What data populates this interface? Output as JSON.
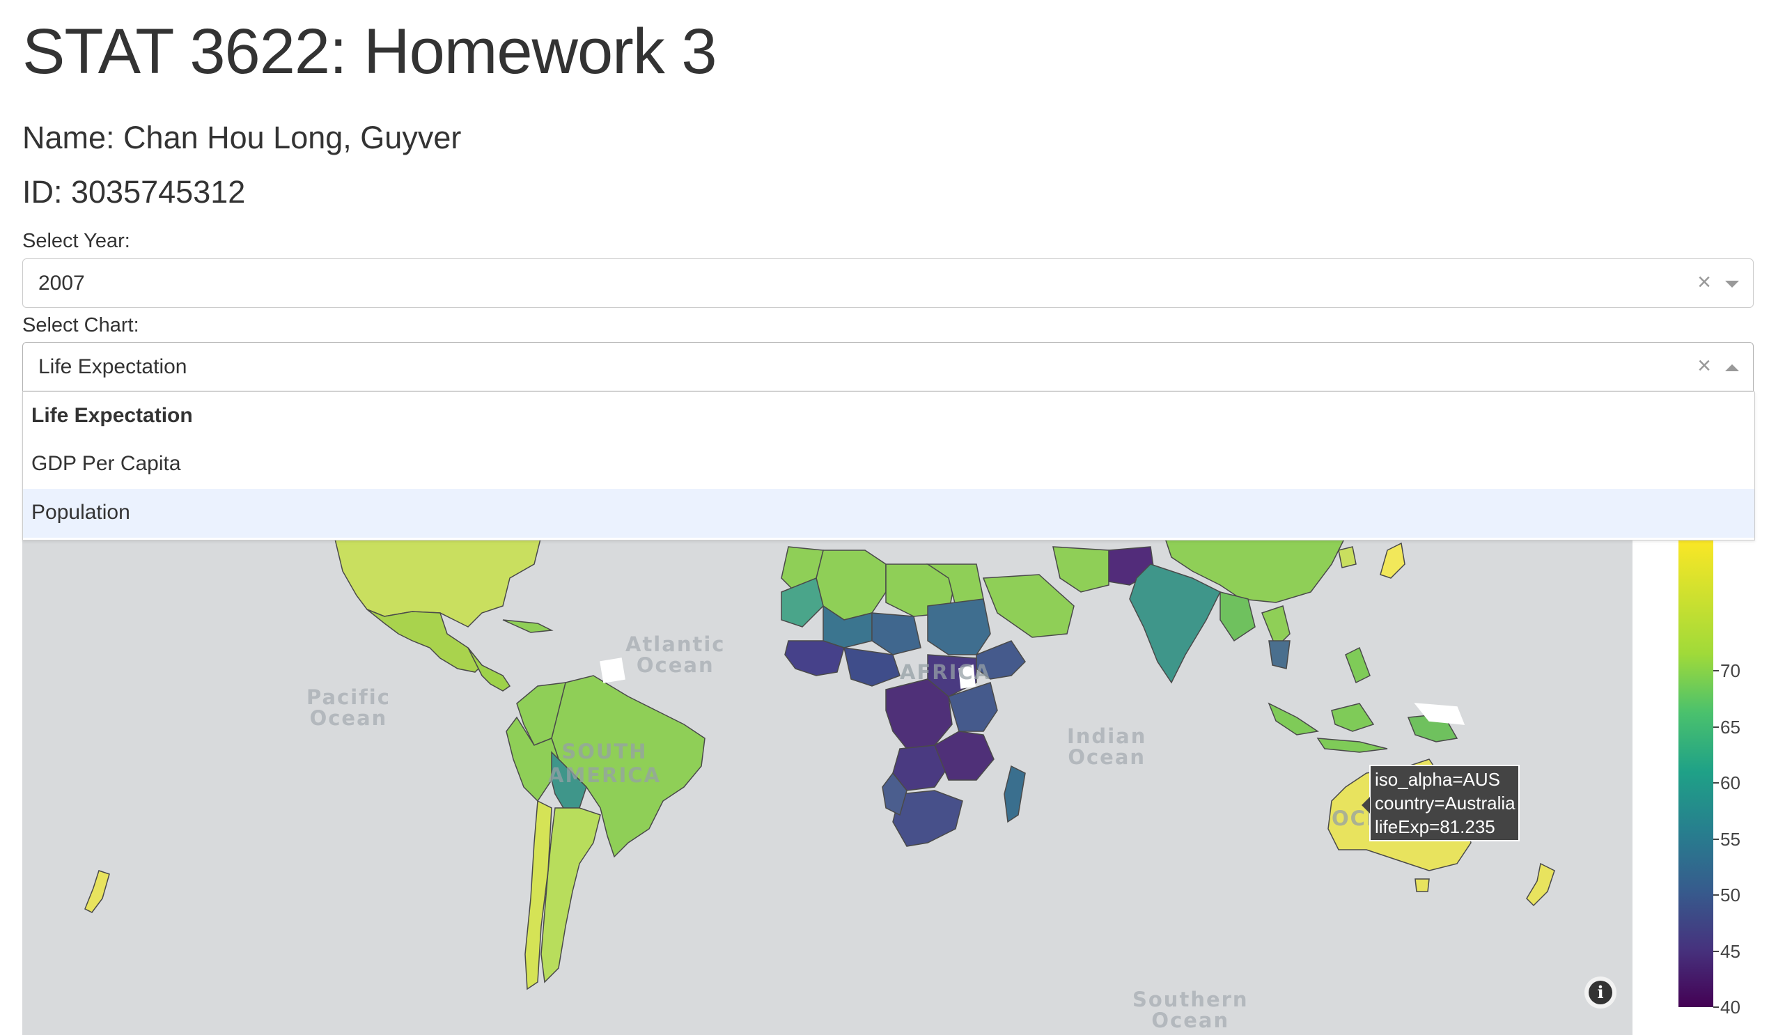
{
  "page": {
    "title": "STAT 3622: Homework 3",
    "name": "Name: Chan Hou Long, Guyver",
    "id": "ID: 3035745312"
  },
  "year_select": {
    "label": "Select Year:",
    "value": "2007",
    "clear": "×"
  },
  "chart_select": {
    "label": "Select Chart:",
    "value": "Life Expectation",
    "clear": "×",
    "options": [
      "Life Expectation",
      "GDP Per Capita",
      "Population"
    ],
    "selected_index": 0,
    "hovered_index": 2
  },
  "map": {
    "ocean_labels": {
      "atlantic": "Atlantic\nOcean",
      "pacific": "Pacific\nOcean",
      "indian": "Indian\nOcean",
      "southern": "Southern\nOcean"
    },
    "continent_labels": {
      "south_america": "SOUTH\nAMERICA",
      "africa": "AFRICA",
      "oceania": "OCE"
    },
    "tooltip": {
      "line1": "iso_alpha=AUS",
      "line2": "country=Australia",
      "line3": "lifeExp=81.235"
    },
    "info_icon": "i",
    "colors": {
      "ocean": "#d8dadc",
      "high": "#e8e35e",
      "low": "#4b2a6e"
    }
  },
  "colorbar": {
    "ticks": [
      "70",
      "65",
      "60",
      "55",
      "50",
      "45",
      "40"
    ],
    "range": [
      40,
      82
    ],
    "colorscale": "viridis"
  }
}
